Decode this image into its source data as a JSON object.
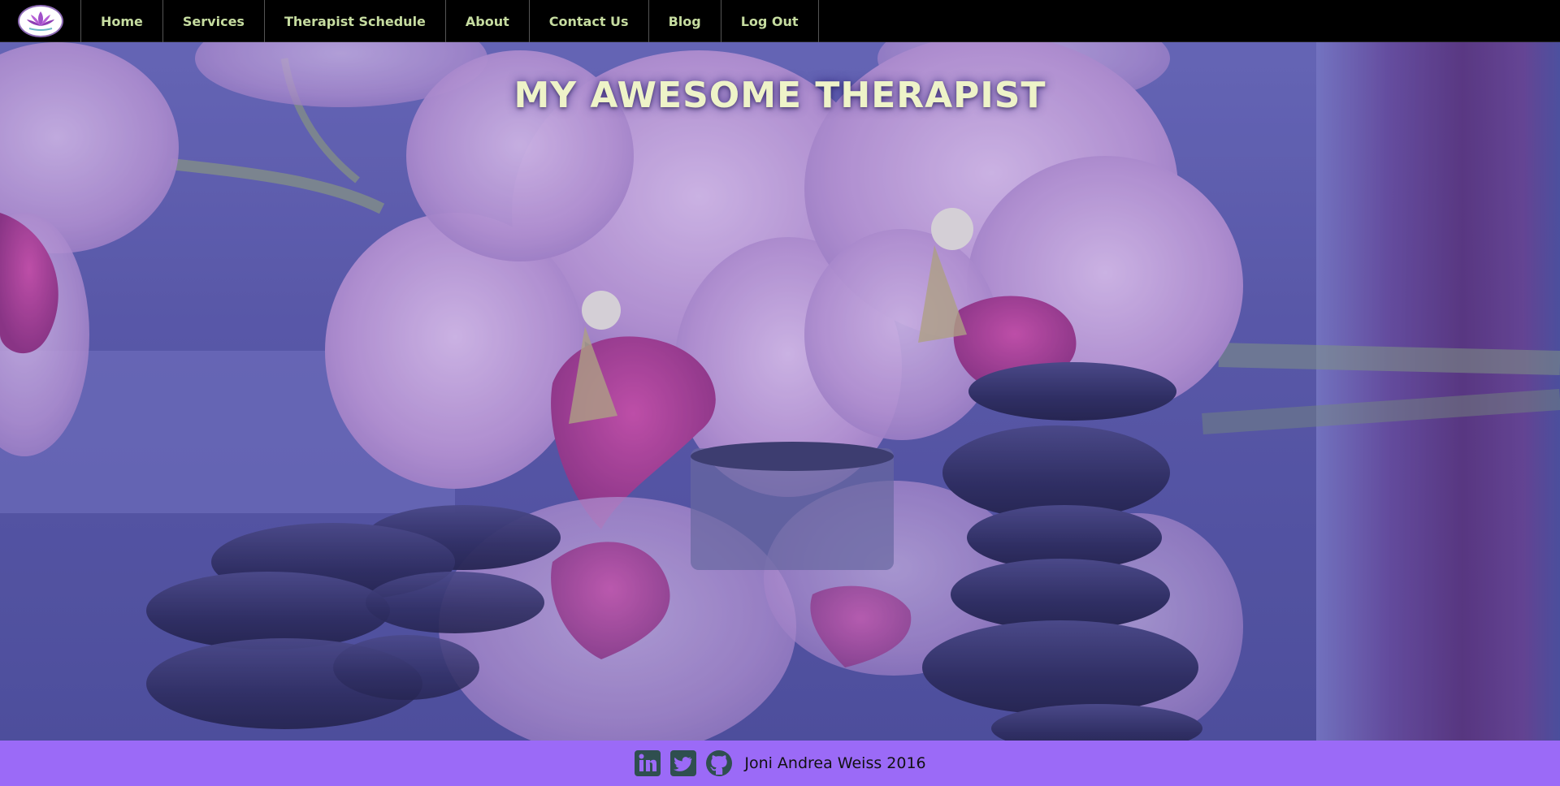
{
  "nav": {
    "items": [
      {
        "label": "Home"
      },
      {
        "label": "Services"
      },
      {
        "label": "Therapist Schedule"
      },
      {
        "label": "About"
      },
      {
        "label": "Contact Us"
      },
      {
        "label": "Blog"
      },
      {
        "label": "Log Out"
      }
    ],
    "logo_icon": "lotus-logo-icon",
    "text_color": "#c6dca0",
    "background": "#000000"
  },
  "hero": {
    "title": "MY AWESOME THERAPIST",
    "image": "orchids-and-stacked-stones-background",
    "tint": "#5a5aa6"
  },
  "footer": {
    "social_icons": [
      "linkedin-icon",
      "twitter-icon",
      "github-icon"
    ],
    "text": "Joni Andrea Weiss 2016",
    "background": "#9b6af7"
  }
}
